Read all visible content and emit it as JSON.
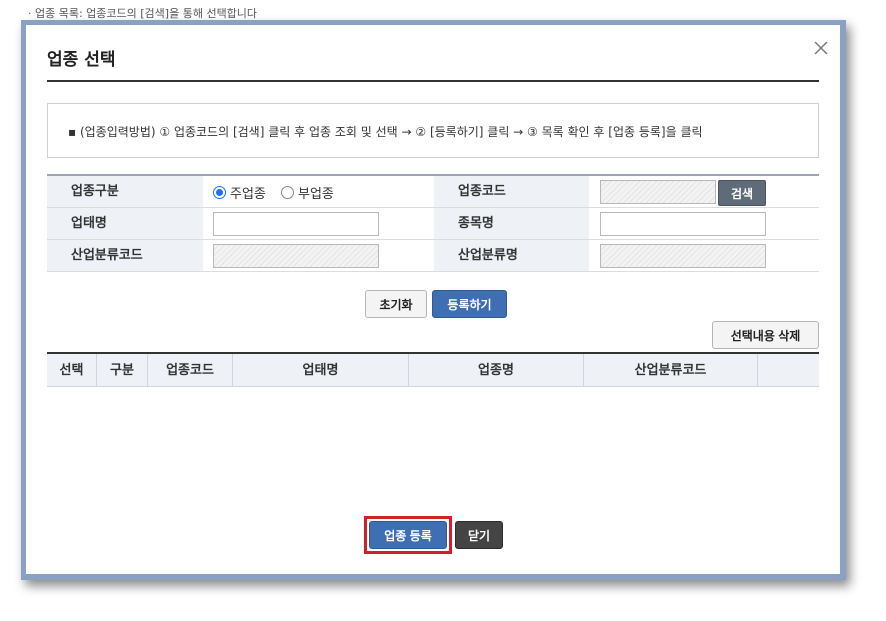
{
  "top_strip": "· 업종 목록: 업종코드의 [검색]을 통해 선택합니다",
  "dialog": {
    "title": "업종 선택",
    "close_glyph": "✕",
    "notice": "▪ (업종입력방법) ① 업종코드의 [검색] 클릭 후 업종 조회 및 선택 → ② [등록하기] 클릭 → ③ 목록 확인 후 [업종 등록]을 클릭"
  },
  "form": {
    "type_label": "업종구분",
    "type_options": [
      {
        "label": "주업종",
        "selected": true
      },
      {
        "label": "부업종",
        "selected": false
      }
    ],
    "code_label": "업종코드",
    "code_value": "",
    "search_button": "검색",
    "business_label": "업태명",
    "business_value": "",
    "item_label": "종목명",
    "item_value": "",
    "industry_code_label": "산업분류코드",
    "industry_code_value": "",
    "industry_name_label": "산업분류명",
    "industry_name_value": ""
  },
  "actions": {
    "reset": "초기화",
    "register": "등록하기",
    "delete_selected": "선택내용 삭제"
  },
  "grid": {
    "columns": [
      "선택",
      "구분",
      "업종코드",
      "업태명",
      "업종명",
      "산업분류코드",
      ""
    ]
  },
  "footer": {
    "submit": "업종 등록",
    "close": "닫기"
  },
  "colors": {
    "primary": "#3e6fb2",
    "frame": "#8aa1c4",
    "highlight": "#d0212a"
  }
}
